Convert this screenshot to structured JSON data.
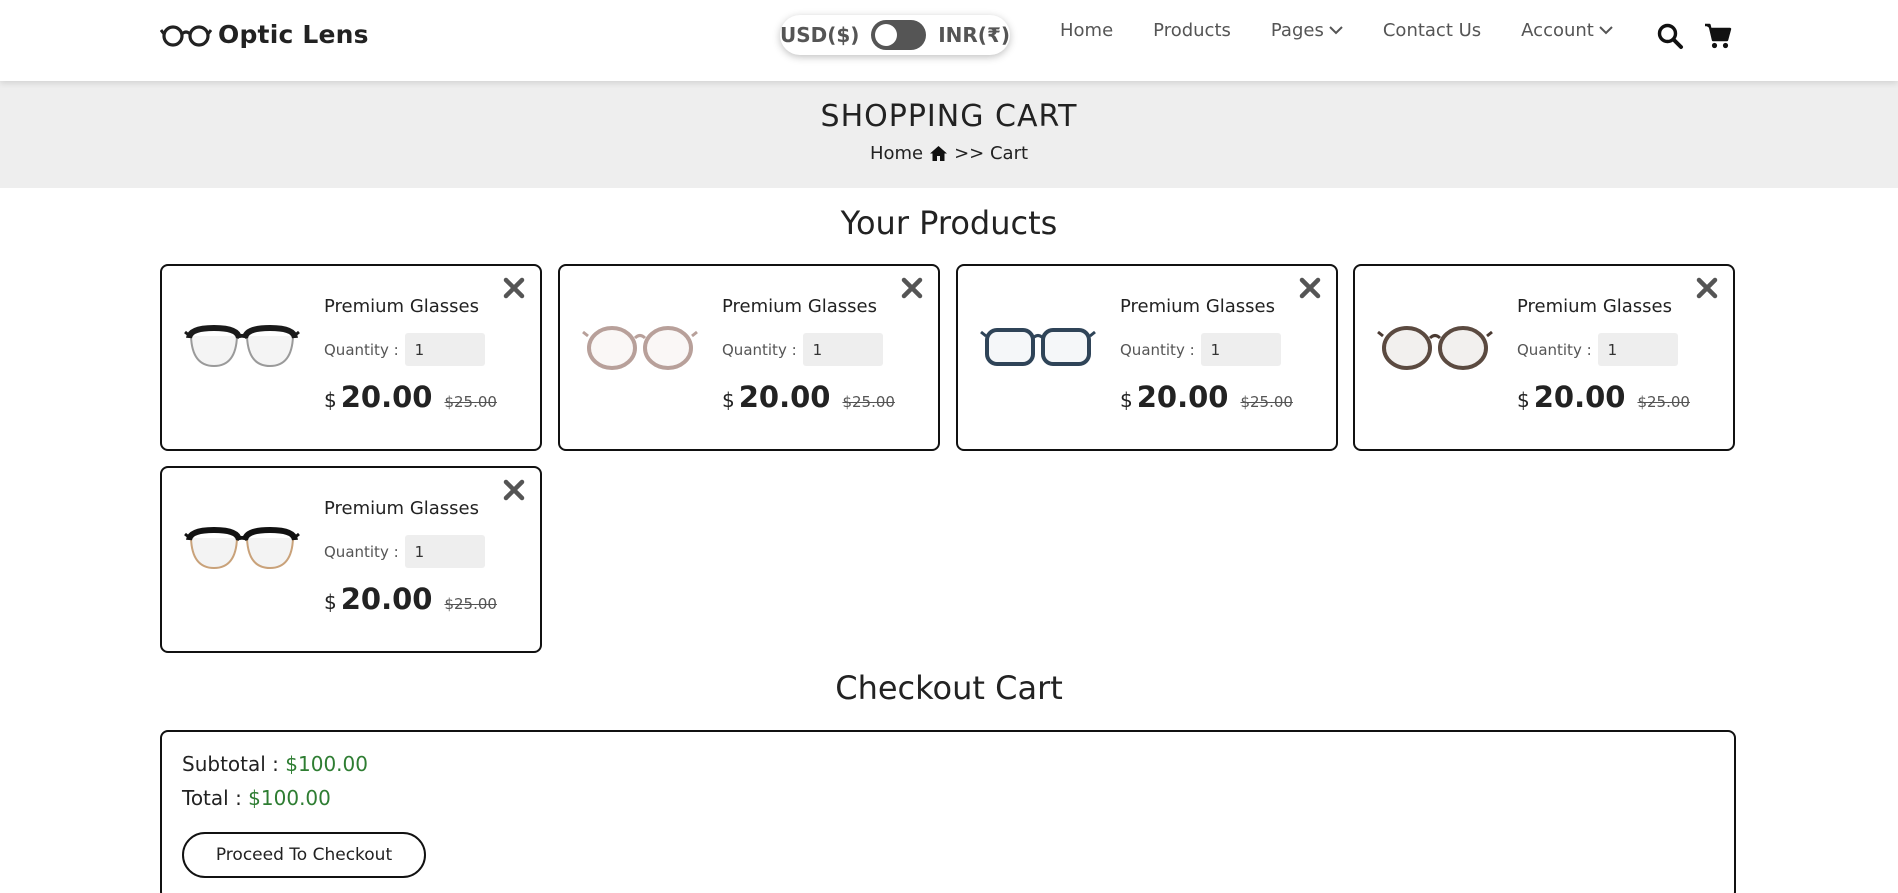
{
  "header": {
    "brand": "Optic Lens",
    "currency": {
      "left": "USD($)",
      "right": "INR(₹)",
      "toggle_on": false
    },
    "nav": [
      {
        "label": "Home"
      },
      {
        "label": "Products"
      },
      {
        "label": "Pages"
      },
      {
        "label": "Contact Us"
      },
      {
        "label": "Account"
      }
    ]
  },
  "banner": {
    "title": "SHOPPING CART",
    "breadcrumb_home": "Home",
    "breadcrumb_rest": ">> Cart"
  },
  "products": {
    "title": "Your Products",
    "quantity_label": "Quantity :",
    "currency_symbol": "$",
    "items": [
      {
        "name": "Premium Glasses",
        "quantity": "1",
        "price": "20.00",
        "old_price": "$25.00",
        "frame": "black-browline"
      },
      {
        "name": "Premium Glasses",
        "quantity": "1",
        "price": "20.00",
        "old_price": "$25.00",
        "frame": "pink-round"
      },
      {
        "name": "Premium Glasses",
        "quantity": "1",
        "price": "20.00",
        "old_price": "$25.00",
        "frame": "blue-rect"
      },
      {
        "name": "Premium Glasses",
        "quantity": "1",
        "price": "20.00",
        "old_price": "$25.00",
        "frame": "tortoise-round"
      },
      {
        "name": "Premium Glasses",
        "quantity": "1",
        "price": "20.00",
        "old_price": "$25.00",
        "frame": "black-clubmaster"
      }
    ]
  },
  "checkout": {
    "title": "Checkout Cart",
    "subtotal_label": "Subtotal :",
    "subtotal_value": "$100.00",
    "total_label": "Total :",
    "total_value": "$100.00",
    "button_label": "Proceed To Checkout"
  },
  "colors": {
    "accent_green": "#2e7d32",
    "toggle_bg": "#555555",
    "banner_bg": "#eeeeee"
  }
}
